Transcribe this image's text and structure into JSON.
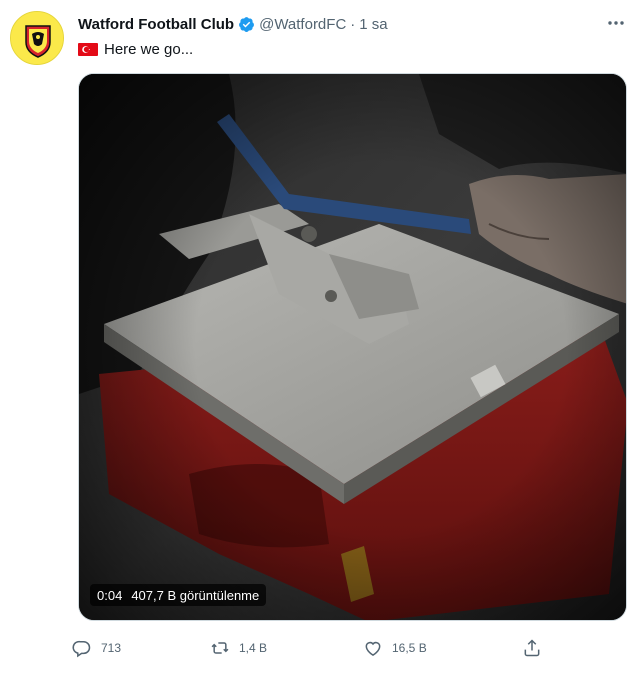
{
  "tweet": {
    "author_name": "Watford Football Club",
    "handle": "@WatfordFC",
    "separator": "·",
    "time": "1 sa",
    "text": "Here we go..."
  },
  "icons": {
    "verified": "verified-badge-icon",
    "more": "more-dots-icon",
    "flag": "turkey-flag-icon",
    "reply": "reply-icon",
    "retweet": "retweet-icon",
    "like": "like-icon",
    "share": "share-icon"
  },
  "video": {
    "timestamp": "0:04",
    "views": "407,7 B görüntülenme"
  },
  "actions": {
    "replies": "713",
    "retweets": "1,4 B",
    "likes": "16,5 B"
  },
  "colors": {
    "verified": "#1d9bf0",
    "text_secondary": "#536471",
    "watford_yellow": "#fbe94a",
    "watford_red": "#d6242b",
    "turkey_red": "#e30a17"
  }
}
